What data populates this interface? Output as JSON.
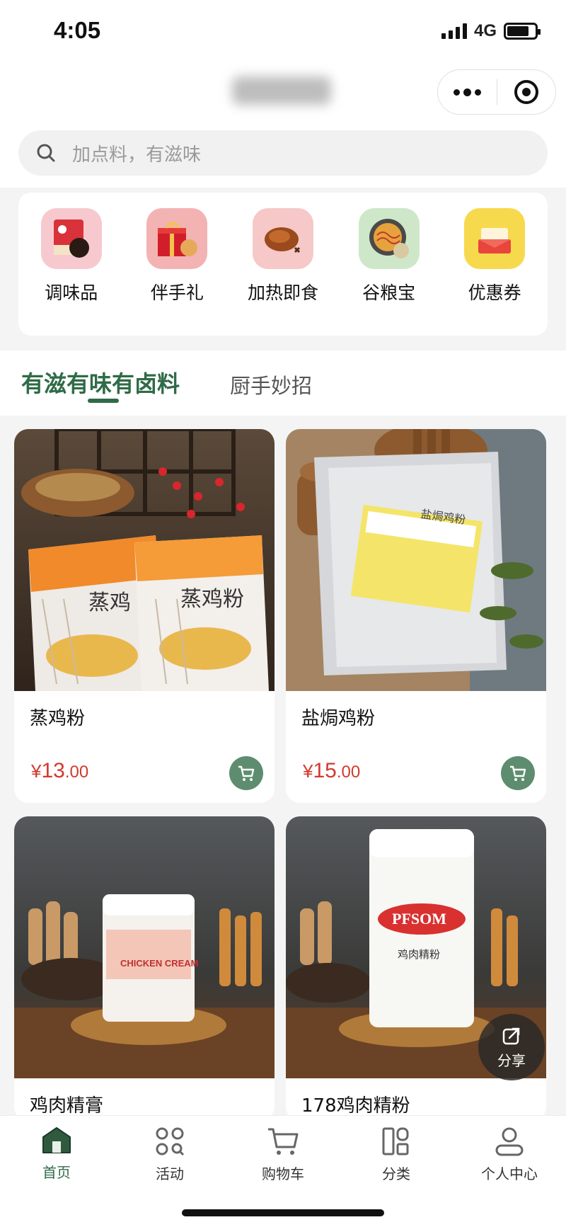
{
  "status": {
    "time": "4:05",
    "network": "4G"
  },
  "search": {
    "placeholder": "加点料，有滋味"
  },
  "categories": [
    {
      "label": "调味品",
      "icon": "seasoning-box-icon",
      "color": "#f7c9cf"
    },
    {
      "label": "伴手礼",
      "icon": "gift-box-icon",
      "color": "#f3b3b3"
    },
    {
      "label": "加热即食",
      "icon": "roast-chicken-icon",
      "color": "#f6c8c8"
    },
    {
      "label": "谷粮宝",
      "icon": "noodle-bowl-icon",
      "color": "#cfe7c9"
    },
    {
      "label": "优惠券",
      "icon": "coupon-icon",
      "color": "#f7d94e"
    }
  ],
  "tabs": {
    "active": "有滋有味有卤料",
    "inactive": "厨手妙招"
  },
  "products": [
    {
      "name": "蒸鸡粉",
      "currency": "¥",
      "price_int": "13",
      "price_dec": ".00"
    },
    {
      "name": "盐焗鸡粉",
      "currency": "¥",
      "price_int": "15",
      "price_dec": ".00"
    },
    {
      "name": "鸡肉精膏"
    },
    {
      "name": "178鸡肉精粉"
    }
  ],
  "share": {
    "label": "分享"
  },
  "tabbar": [
    {
      "label": "首页",
      "icon": "home-icon",
      "active": true
    },
    {
      "label": "活动",
      "icon": "activity-icon"
    },
    {
      "label": "购物车",
      "icon": "cart-icon"
    },
    {
      "label": "分类",
      "icon": "category-icon"
    },
    {
      "label": "个人中心",
      "icon": "profile-icon"
    }
  ],
  "colors": {
    "accent": "#2f6b47",
    "price": "#d23a2d",
    "cart": "#5d8d6e"
  }
}
